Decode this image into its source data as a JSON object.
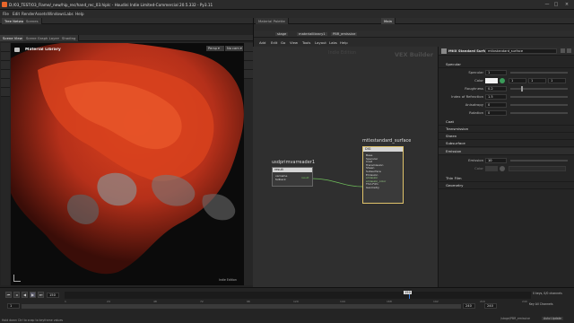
{
  "window": {
    "title": "D:/03_TEST/03_Flame/_new/hip_rec/hand_rec_03.hiplc - Houdini Indie Limited-Commercial 20.5.332 - Py3.11",
    "buttons": [
      "—",
      "□",
      "×"
    ]
  },
  "menubar": {
    "items": [
      "File",
      "Edit",
      "Render",
      "Assets",
      "Windows",
      "Labs",
      "Help"
    ]
  },
  "left_panel": {
    "top_tabs": [
      "Tree Network",
      "Scenes"
    ],
    "second_tabs": [
      "Scene View",
      "Scene Graph Layers",
      "Shading"
    ],
    "path": "stage",
    "viewport_label": "Material Library",
    "btn_persp": "Persp ▾",
    "btn_cam": "No cam ▾",
    "watermark": "Indie Edition"
  },
  "right_panel": {
    "top_tabs": [
      "Material Palette",
      "Main"
    ],
    "path_items": [
      "stage",
      "materiallibrary1",
      "PBR_emissive"
    ],
    "menu": [
      "Add",
      "Edit",
      "Go",
      "View",
      "Tools",
      "Layout",
      "Labs",
      "Help"
    ],
    "network_watermark_left": "Indie Edition",
    "network_watermark_right": "VEX Builder",
    "node_surface_title": "mtlxstandard_surface",
    "node_surface_header": "DIG",
    "node_surface_inputs": [
      "Base",
      "Specular",
      "Coat",
      "Transmission",
      "Sheen",
      "Subsurface",
      "Emission",
      "emission",
      "emission_color",
      "Thin Film",
      "Geometry"
    ],
    "node_reader_title": "usdprimvarreader1",
    "node_reader_header": "result",
    "node_reader_rows": [
      "varname",
      "fallback"
    ],
    "node_reader_output": "result"
  },
  "params": {
    "node_type": "MtlX Standard Surface",
    "node_name": "mtlxstandard_surface",
    "sections": {
      "specular": "Specular",
      "coat": "Coat",
      "transmission": "Transmission",
      "sheen": "Sheen",
      "subsurface": "Subsurface",
      "emission": "Emission",
      "thin_film": "Thin Film",
      "geometry": "Geometry"
    },
    "specular_rows": [
      {
        "label": "Specular",
        "value": "1"
      },
      {
        "label": "Color",
        "value": "1"
      },
      {
        "label": "Roughness",
        "value": "0.2"
      },
      {
        "label": "Index of Refraction",
        "value": "1.5"
      },
      {
        "label": "Anisotropy",
        "value": "0"
      },
      {
        "label": "Rotation",
        "value": "0"
      }
    ],
    "color_values": [
      "1",
      "1",
      "1"
    ],
    "emission_rows": [
      {
        "label": "Emission",
        "value": "10"
      },
      {
        "label": "Color",
        "value": ""
      }
    ]
  },
  "timeline": {
    "frame": "150",
    "start": "1",
    "end": "240",
    "end2": "240",
    "status": "Hold down Ctrl to snap to keyframe values",
    "key_count": "0 keys, 0/0 channels",
    "key_all": "Key All Channels",
    "auto_update": "Auto Update",
    "path_right": "/stage/PBR_emissive",
    "ticks": [
      "1",
      "24",
      "48",
      "72",
      "96",
      "120",
      "144",
      "168",
      "192",
      "216",
      "240"
    ]
  },
  "colors": {
    "accent": "#e8662b",
    "emission_red": "#c4391c",
    "wire": "#6fbf5b"
  }
}
